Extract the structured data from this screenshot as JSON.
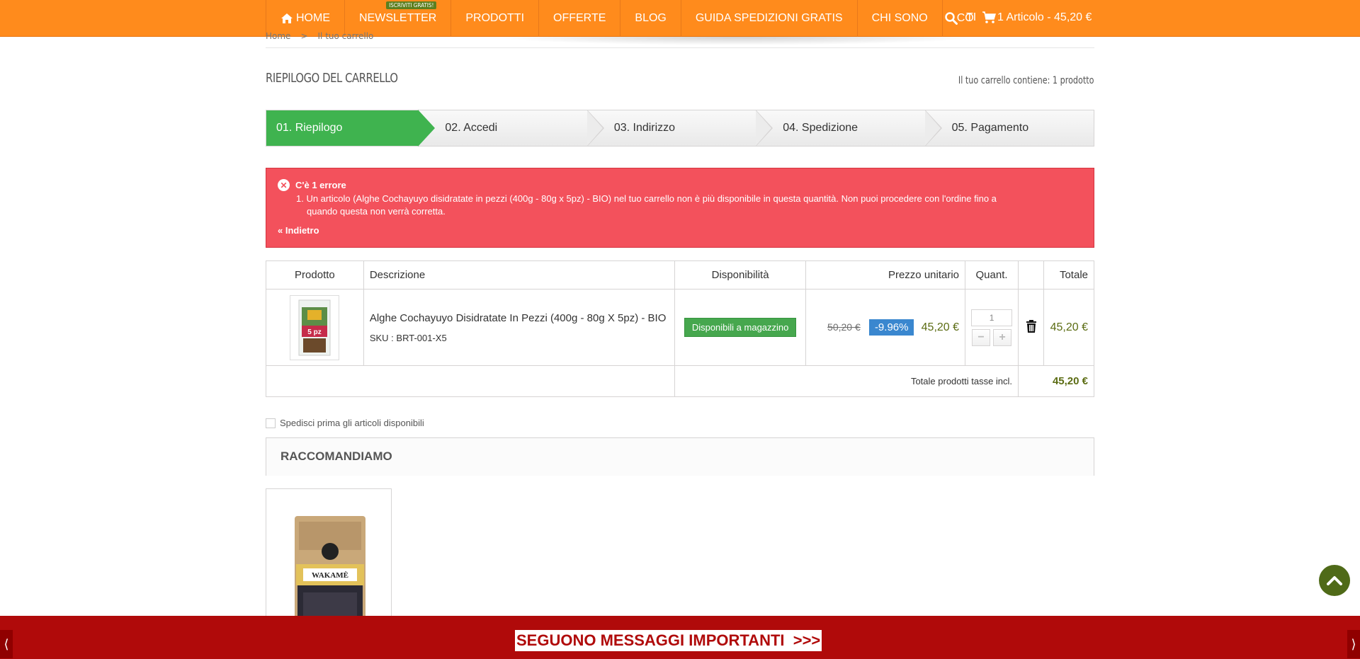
{
  "nav": {
    "items": [
      "HOME",
      "NEWSLETTER",
      "PRODOTTI",
      "OFFERTE",
      "BLOG",
      "GUIDA SPEDIZIONI GRATIS",
      "CHI SONO",
      "CO"
    ],
    "newsletter_badge": "ISCRIVITI GRATIS!",
    "partial_after_search": "TI",
    "cart_label": "1 Articolo - 45,20 €"
  },
  "breadcrumb": [
    "Home",
    ">",
    "Il tuo carrello"
  ],
  "page": {
    "title": "RIEPILOGO DEL CARRELLO",
    "cart_count": "Il tuo carrello contiene: 1 prodotto"
  },
  "steps": [
    "01. Riepilogo",
    "02. Accedi",
    "03. Indirizzo",
    "04. Spedizione",
    "05. Pagamento"
  ],
  "error": {
    "icon": "close-icon",
    "heading": "C'è 1 errore",
    "message_line1": "1. Un articolo (Alghe Cochayuyo disidratate in pezzi (400g - 80g x 5pz) - BIO) nel tuo carrello non è più disponibile in questa quantità. Non puoi procedere con l'ordine fino a",
    "message_line2": "quando questa non verrà corretta.",
    "back_link": "« Indietro"
  },
  "table": {
    "headers": {
      "product": "Prodotto",
      "description": "Descrizione",
      "availability": "Disponibilità",
      "unit_price": "Prezzo unitario",
      "quantity": "Quant.",
      "total": "Totale"
    },
    "row": {
      "thumb_label": "5 pz",
      "name": "Alghe Cochayuyo Disidratate In Pezzi (400g - 80g X 5pz) - BIO",
      "sku": "SKU : BRT-001-X5",
      "availability": "Disponibili a magazzino",
      "old_price": "50,20 €",
      "discount": "-9.96%",
      "price": "45,20 €",
      "quantity": "1",
      "total": "45,20 €"
    },
    "footer": {
      "label": "Totale prodotti tasse incl.",
      "value": "45,20 €"
    }
  },
  "ship_first_label": "Spedisci prima gli articoli disponibili",
  "recommend": {
    "title": "RACCOMANDIAMO",
    "product_text": "WAKAMÈ"
  },
  "banner": {
    "message": "SEGUONO MESSAGGI IMPORTANTI  >>>",
    "prev": "⟨",
    "next": "⟩"
  },
  "colors": {
    "nav_bg": "#ff8b1c",
    "step_active": "#3fb34f",
    "error_bg": "#f3515c",
    "availability_badge": "#46a74e",
    "discount_badge": "#3a87cf",
    "price": "#5b6c13",
    "banner_bg": "#b00a0a",
    "to_top_bg": "#4f6a18"
  }
}
